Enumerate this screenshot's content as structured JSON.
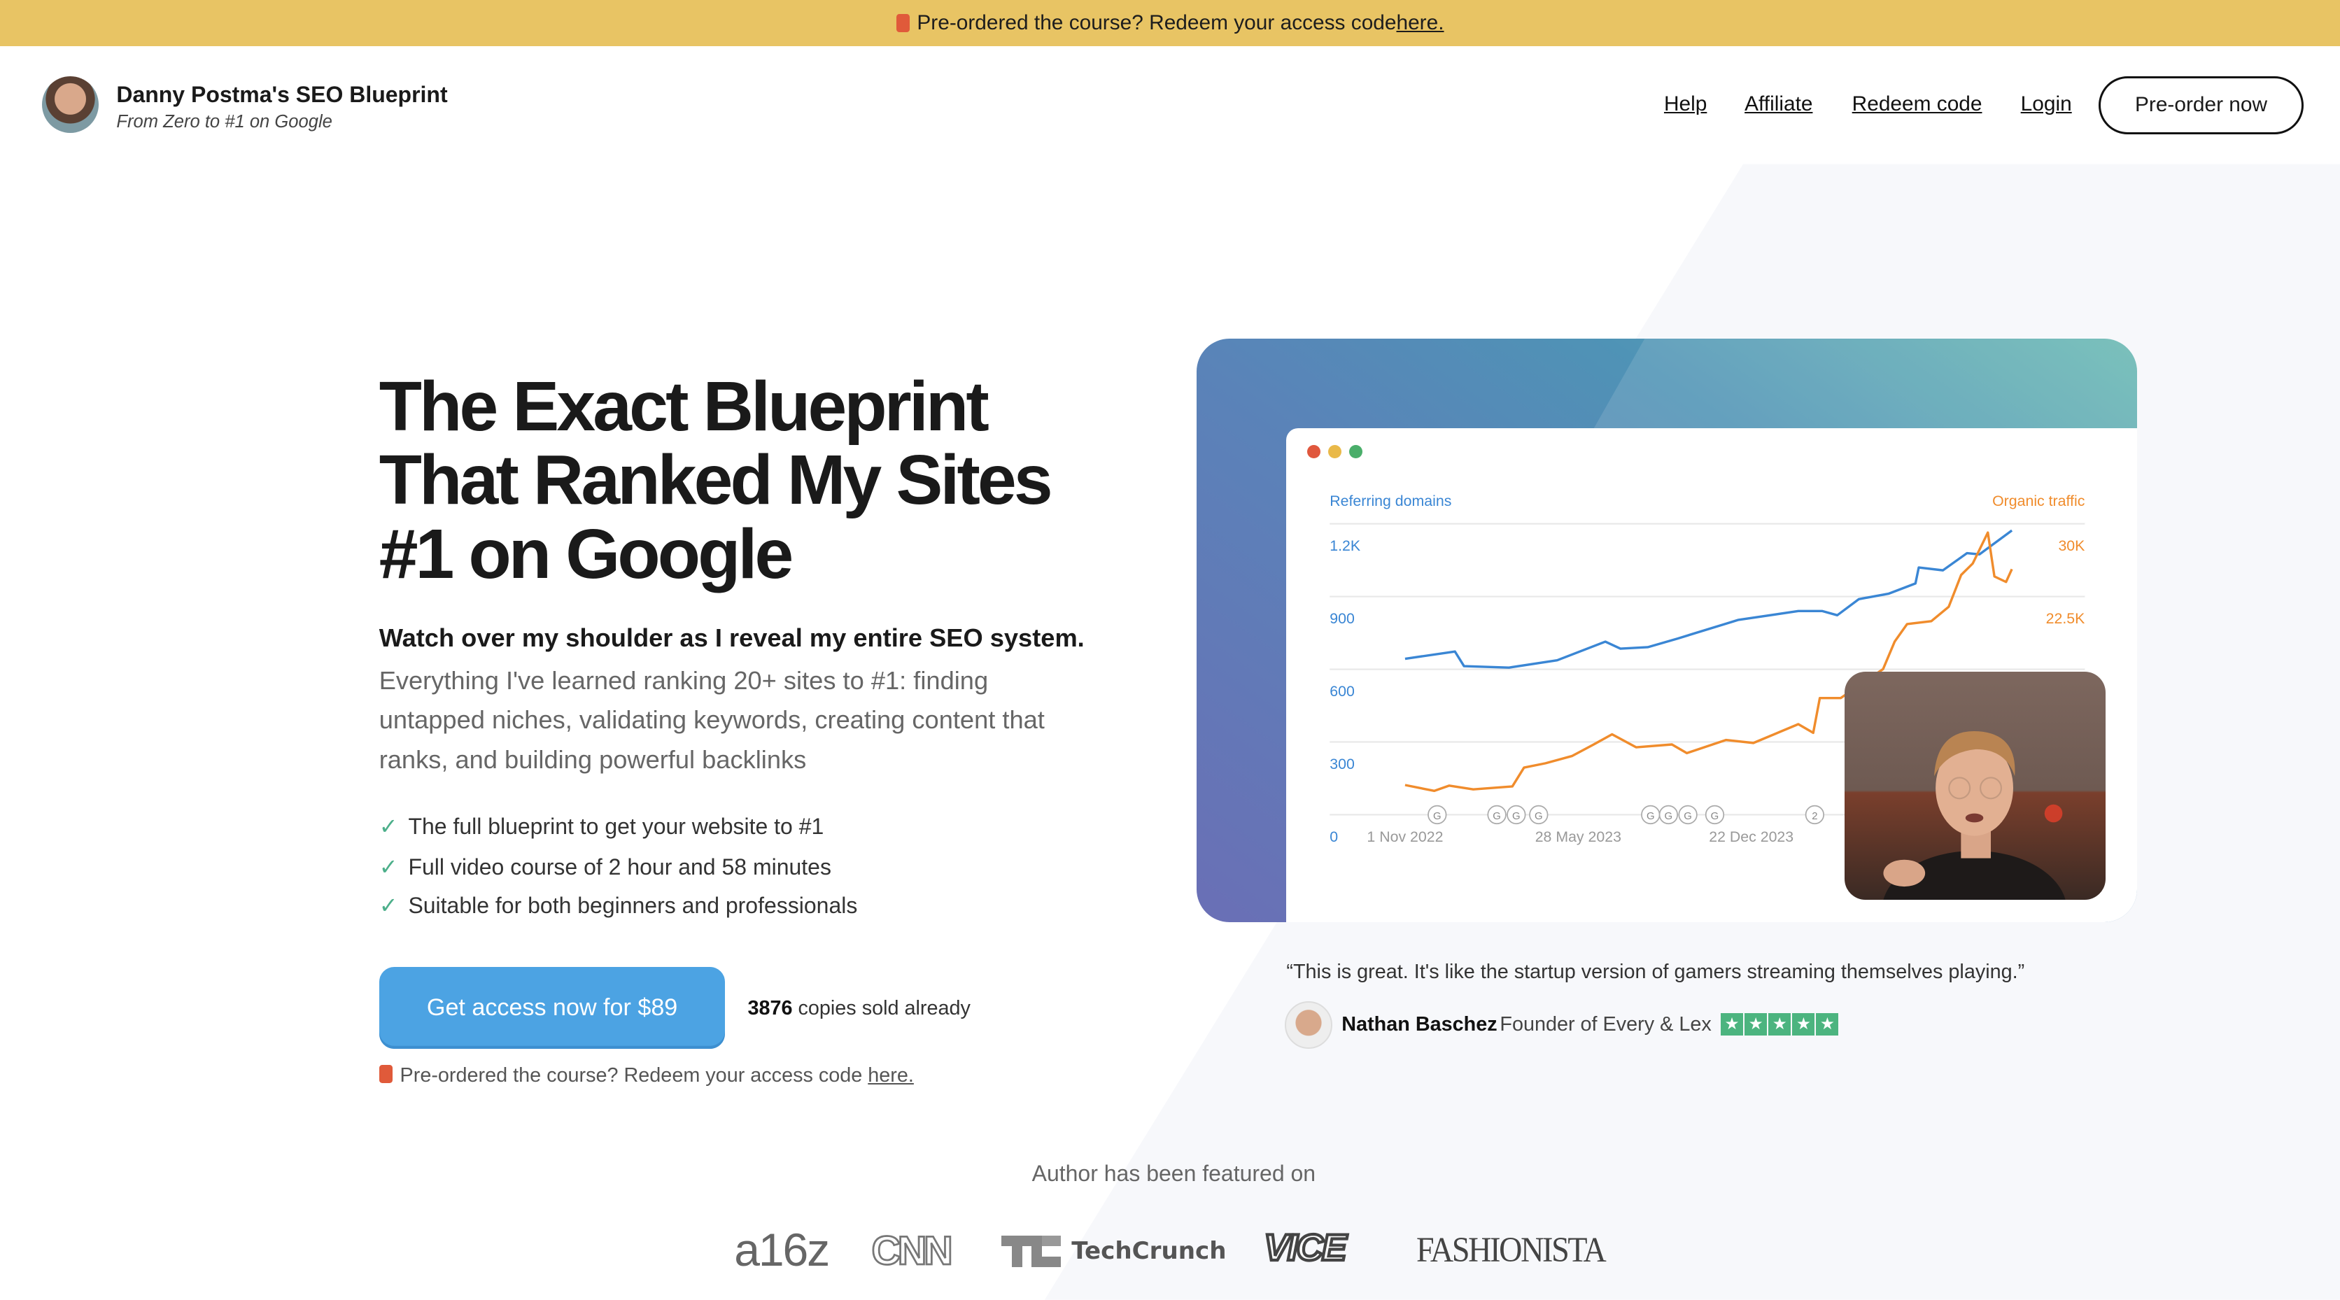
{
  "banner": {
    "text": "Pre-ordered the course? Redeem your access code ",
    "link": "here.",
    "icon": "ticket-icon"
  },
  "header": {
    "title": "Danny Postma's SEO Blueprint",
    "subtitle": "From Zero to #1 on Google",
    "nav": [
      "Help",
      "Affiliate",
      "Redeem code",
      "Login"
    ],
    "cta": "Pre-order now"
  },
  "hero": {
    "headline": "The Exact Blueprint That Ranked My Sites #1 on Google",
    "lead": "Watch over my shoulder as I reveal my entire SEO system.",
    "paragraph": "Everything I've learned ranking 20+ sites to #1: finding untapped niches, validating keywords, creating content that ranks, and building powerful backlinks",
    "checks": [
      "The full blueprint to get your website to #1",
      "Full video course of 2 hour and 58 minutes",
      "Suitable for both beginners and professionals"
    ],
    "cta": "Get access now for $89",
    "sold_count": "3876",
    "sold_text": " copies sold already",
    "redeem_text": "Pre-ordered the course? Redeem your access code ",
    "redeem_link": "here."
  },
  "testimonial": {
    "quote": "“This is great. It's like the startup version of gamers streaming themselves playing.”",
    "name": "Nathan Baschez",
    "role": "Founder of Every & Lex",
    "rating": 5
  },
  "featured": {
    "heading": "Author has been featured on",
    "logos": [
      "a16z",
      "CNN",
      "TechCrunch",
      "VICE",
      "FASHIONISTA"
    ]
  },
  "colors": {
    "banner": "#e8c464",
    "cta": "#4ca3e3",
    "check": "#4caf8a",
    "stars": "#4cb47f",
    "series_blue": "#3a86d4",
    "series_orange": "#f08c2c"
  },
  "chart_data": {
    "type": "line",
    "left_label": "Referring domains",
    "right_label": "Organic traffic",
    "left_ticks": [
      "0",
      "300",
      "600",
      "900",
      "1.2K"
    ],
    "right_ticks": [
      "22.5K",
      "30K"
    ],
    "x_ticks": [
      "1 Nov 2022",
      "28 May 2023",
      "22 Dec 2023"
    ],
    "left_ylim": [
      0,
      1200
    ],
    "right_ylim": [
      0,
      30000
    ],
    "grid": true,
    "annotations": [
      "G",
      "G",
      "G",
      "G",
      "G",
      "G",
      "G",
      "G",
      "2"
    ],
    "series": [
      {
        "name": "Referring domains",
        "axis": "left",
        "points": [
          [
            "2022-11-01",
            643
          ],
          [
            "2022-12-31",
            673
          ],
          [
            "2023-01-11",
            613
          ],
          [
            "2023-03-06",
            607
          ],
          [
            "2023-05-03",
            637
          ],
          [
            "2023-06-30",
            714
          ],
          [
            "2023-07-18",
            685
          ],
          [
            "2023-08-20",
            691
          ],
          [
            "2023-09-25",
            727
          ],
          [
            "2023-12-07",
            804
          ],
          [
            "2024-02-17",
            840
          ],
          [
            "2024-03-17",
            840
          ],
          [
            "2024-04-04",
            823
          ],
          [
            "2024-04-30",
            889
          ],
          [
            "2024-06-05",
            912
          ],
          [
            "2024-07-07",
            954
          ],
          [
            "2024-07-11",
            1020
          ],
          [
            "2024-08-09",
            1008
          ],
          [
            "2024-09-07",
            1079
          ],
          [
            "2024-09-22",
            1074
          ],
          [
            "2024-10-31",
            1172
          ]
        ]
      },
      {
        "name": "Organic traffic",
        "axis": "right",
        "points": [
          [
            "2022-11-01",
            3060
          ],
          [
            "2022-12-06",
            2460
          ],
          [
            "2022-12-24",
            3000
          ],
          [
            "2023-01-22",
            2610
          ],
          [
            "2023-03-10",
            2920
          ],
          [
            "2023-03-24",
            4860
          ],
          [
            "2023-04-19",
            5310
          ],
          [
            "2023-05-21",
            6060
          ],
          [
            "2023-06-16",
            7250
          ],
          [
            "2023-07-08",
            8290
          ],
          [
            "2023-08-06",
            6950
          ],
          [
            "2023-09-18",
            7250
          ],
          [
            "2023-10-06",
            6350
          ],
          [
            "2023-11-22",
            7700
          ],
          [
            "2023-12-25",
            7400
          ],
          [
            "2024-02-17",
            9340
          ],
          [
            "2024-03-06",
            8450
          ],
          [
            "2024-03-14",
            12030
          ],
          [
            "2024-04-08",
            12030
          ],
          [
            "2024-05-29",
            15020
          ],
          [
            "2024-06-12",
            17860
          ],
          [
            "2024-06-27",
            19660
          ],
          [
            "2024-07-26",
            19950
          ],
          [
            "2024-08-16",
            21450
          ],
          [
            "2024-08-31",
            24720
          ],
          [
            "2024-09-14",
            25910
          ],
          [
            "2024-10-02",
            29100
          ],
          [
            "2024-10-10",
            24570
          ],
          [
            "2024-10-24",
            24000
          ],
          [
            "2024-10-31",
            25320
          ]
        ]
      }
    ]
  }
}
